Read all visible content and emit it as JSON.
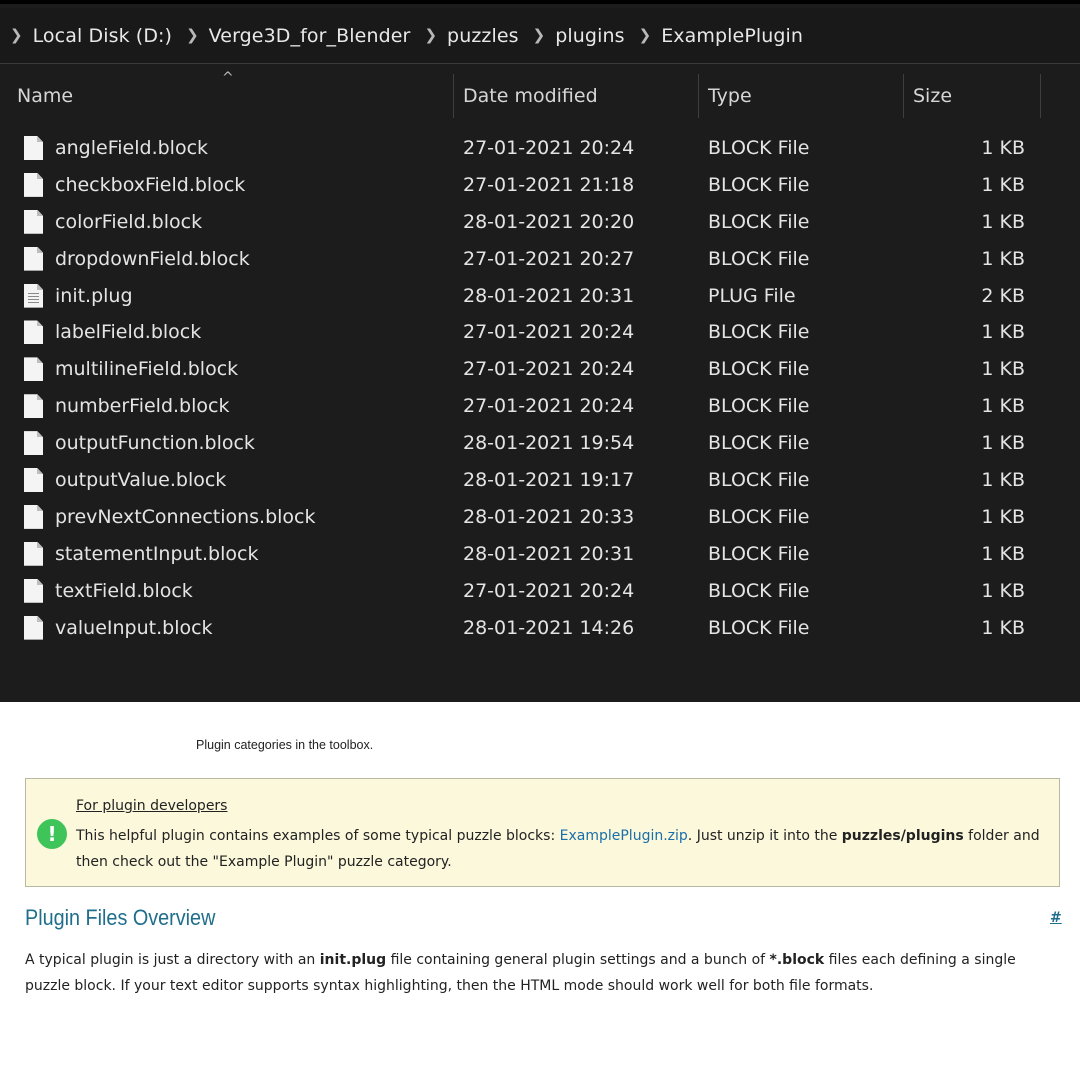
{
  "breadcrumb": [
    "Local Disk (D:)",
    "Verge3D_for_Blender",
    "puzzles",
    "plugins",
    "ExamplePlugin"
  ],
  "columns": {
    "name": "Name",
    "date": "Date modified",
    "type": "Type",
    "size": "Size"
  },
  "sort_indicator": "^",
  "files": [
    {
      "name": "angleField.block",
      "date": "27-01-2021 20:24",
      "type": "BLOCK File",
      "size": "1 KB",
      "icon": "file-icon"
    },
    {
      "name": "checkboxField.block",
      "date": "27-01-2021 21:18",
      "type": "BLOCK File",
      "size": "1 KB",
      "icon": "file-icon"
    },
    {
      "name": "colorField.block",
      "date": "28-01-2021 20:20",
      "type": "BLOCK File",
      "size": "1 KB",
      "icon": "file-icon"
    },
    {
      "name": "dropdownField.block",
      "date": "27-01-2021 20:27",
      "type": "BLOCK File",
      "size": "1 KB",
      "icon": "file-icon"
    },
    {
      "name": "init.plug",
      "date": "28-01-2021 20:31",
      "type": "PLUG File",
      "size": "2 KB",
      "icon": "text-file-icon"
    },
    {
      "name": "labelField.block",
      "date": "27-01-2021 20:24",
      "type": "BLOCK File",
      "size": "1 KB",
      "icon": "file-icon"
    },
    {
      "name": "multilineField.block",
      "date": "27-01-2021 20:24",
      "type": "BLOCK File",
      "size": "1 KB",
      "icon": "file-icon"
    },
    {
      "name": "numberField.block",
      "date": "27-01-2021 20:24",
      "type": "BLOCK File",
      "size": "1 KB",
      "icon": "file-icon"
    },
    {
      "name": "outputFunction.block",
      "date": "28-01-2021 19:54",
      "type": "BLOCK File",
      "size": "1 KB",
      "icon": "file-icon"
    },
    {
      "name": "outputValue.block",
      "date": "28-01-2021 19:17",
      "type": "BLOCK File",
      "size": "1 KB",
      "icon": "file-icon"
    },
    {
      "name": "prevNextConnections.block",
      "date": "28-01-2021 20:33",
      "type": "BLOCK File",
      "size": "1 KB",
      "icon": "file-icon"
    },
    {
      "name": "statementInput.block",
      "date": "28-01-2021 20:31",
      "type": "BLOCK File",
      "size": "1 KB",
      "icon": "file-icon"
    },
    {
      "name": "textField.block",
      "date": "27-01-2021 20:24",
      "type": "BLOCK File",
      "size": "1 KB",
      "icon": "file-icon"
    },
    {
      "name": "valueInput.block",
      "date": "28-01-2021 14:26",
      "type": "BLOCK File",
      "size": "1 KB",
      "icon": "file-icon"
    }
  ],
  "caption": "Plugin categories in the toolbox.",
  "note": {
    "icon": "exclamation-icon",
    "title": "For plugin developers",
    "text_before_link": "This helpful plugin contains examples of some typical puzzle blocks: ",
    "link": "ExamplePlugin.zip",
    "text_after_link": ". Just unzip it into the ",
    "folder": "puzzles/plugins",
    "text_end": " folder and then check out the \"Example Plugin\" puzzle category."
  },
  "section": {
    "heading": "Plugin Files Overview",
    "anchor": "#",
    "p1": "A typical plugin is just a directory with an ",
    "b1": "init.plug",
    "p2": " file containing general plugin settings and a bunch of ",
    "b2": "*.block",
    "p3": " files each defining a single puzzle block. If your text editor supports syntax highlighting, then the HTML mode should work well for both file formats."
  },
  "colors": {
    "explorer_bg": "#1c1c1c",
    "note_bg": "#fbf8dc",
    "link": "#1a6fa8",
    "heading": "#1f6e8c",
    "success_icon": "#3fc45a"
  }
}
